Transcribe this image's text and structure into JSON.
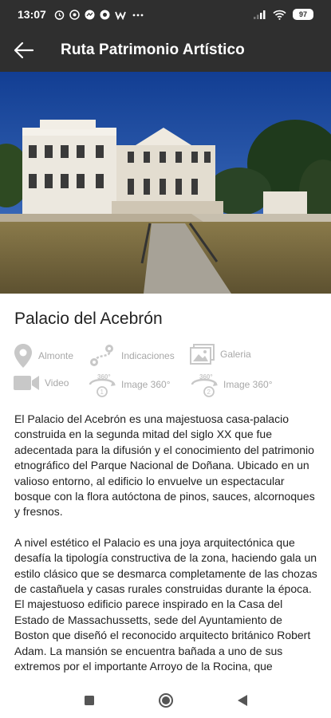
{
  "status_bar": {
    "time": "13:07",
    "battery": "97"
  },
  "app_bar": {
    "title": "Ruta Patrimonio Artístico"
  },
  "place": {
    "title": "Palacio del Acebrón"
  },
  "actions": [
    {
      "label": "Almonte",
      "icon": "location-pin-icon"
    },
    {
      "label": "Indicaciones",
      "icon": "route-icon"
    },
    {
      "label": "Galeria",
      "icon": "gallery-icon"
    },
    {
      "label": "Video",
      "icon": "video-camera-icon"
    },
    {
      "label": "Image 360°",
      "icon": "panorama-360-1-icon"
    },
    {
      "label": "Image 360°",
      "icon": "panorama-360-2-icon"
    }
  ],
  "description": {
    "p1": "El Palacio del Acebrón es una majestuosa casa-palacio construida en la segunda mitad del siglo XX que fue adecentada para la difusión y el conocimiento del patrimonio etnográfico del Parque Nacional de Doñana. Ubicado en un valioso entorno, al edificio lo envuelve un espectacular bosque con la flora autóctona de pinos, sauces, alcornoques y fresnos.",
    "p2": "A nivel estético el Palacio es una joya arquitectónica que desafía la tipología constructiva de la zona, haciendo gala un estilo clásico que se desmarca completamente de las chozas de castañuela y casas rurales construidas durante la época. El majestuoso edificio parece inspirado en la Casa del Estado de Massachussetts, sede del Ayuntamiento de Boston que diseñó el reconocido arquitecto británico Robert Adam. La mansión se encuentra bañada a uno de sus extremos por el importante Arroyo de la Rocina, que"
  },
  "colors": {
    "bar": "#2f2f2f",
    "icon_gray": "#a8a8a8",
    "sky": "#1f4fa8"
  }
}
